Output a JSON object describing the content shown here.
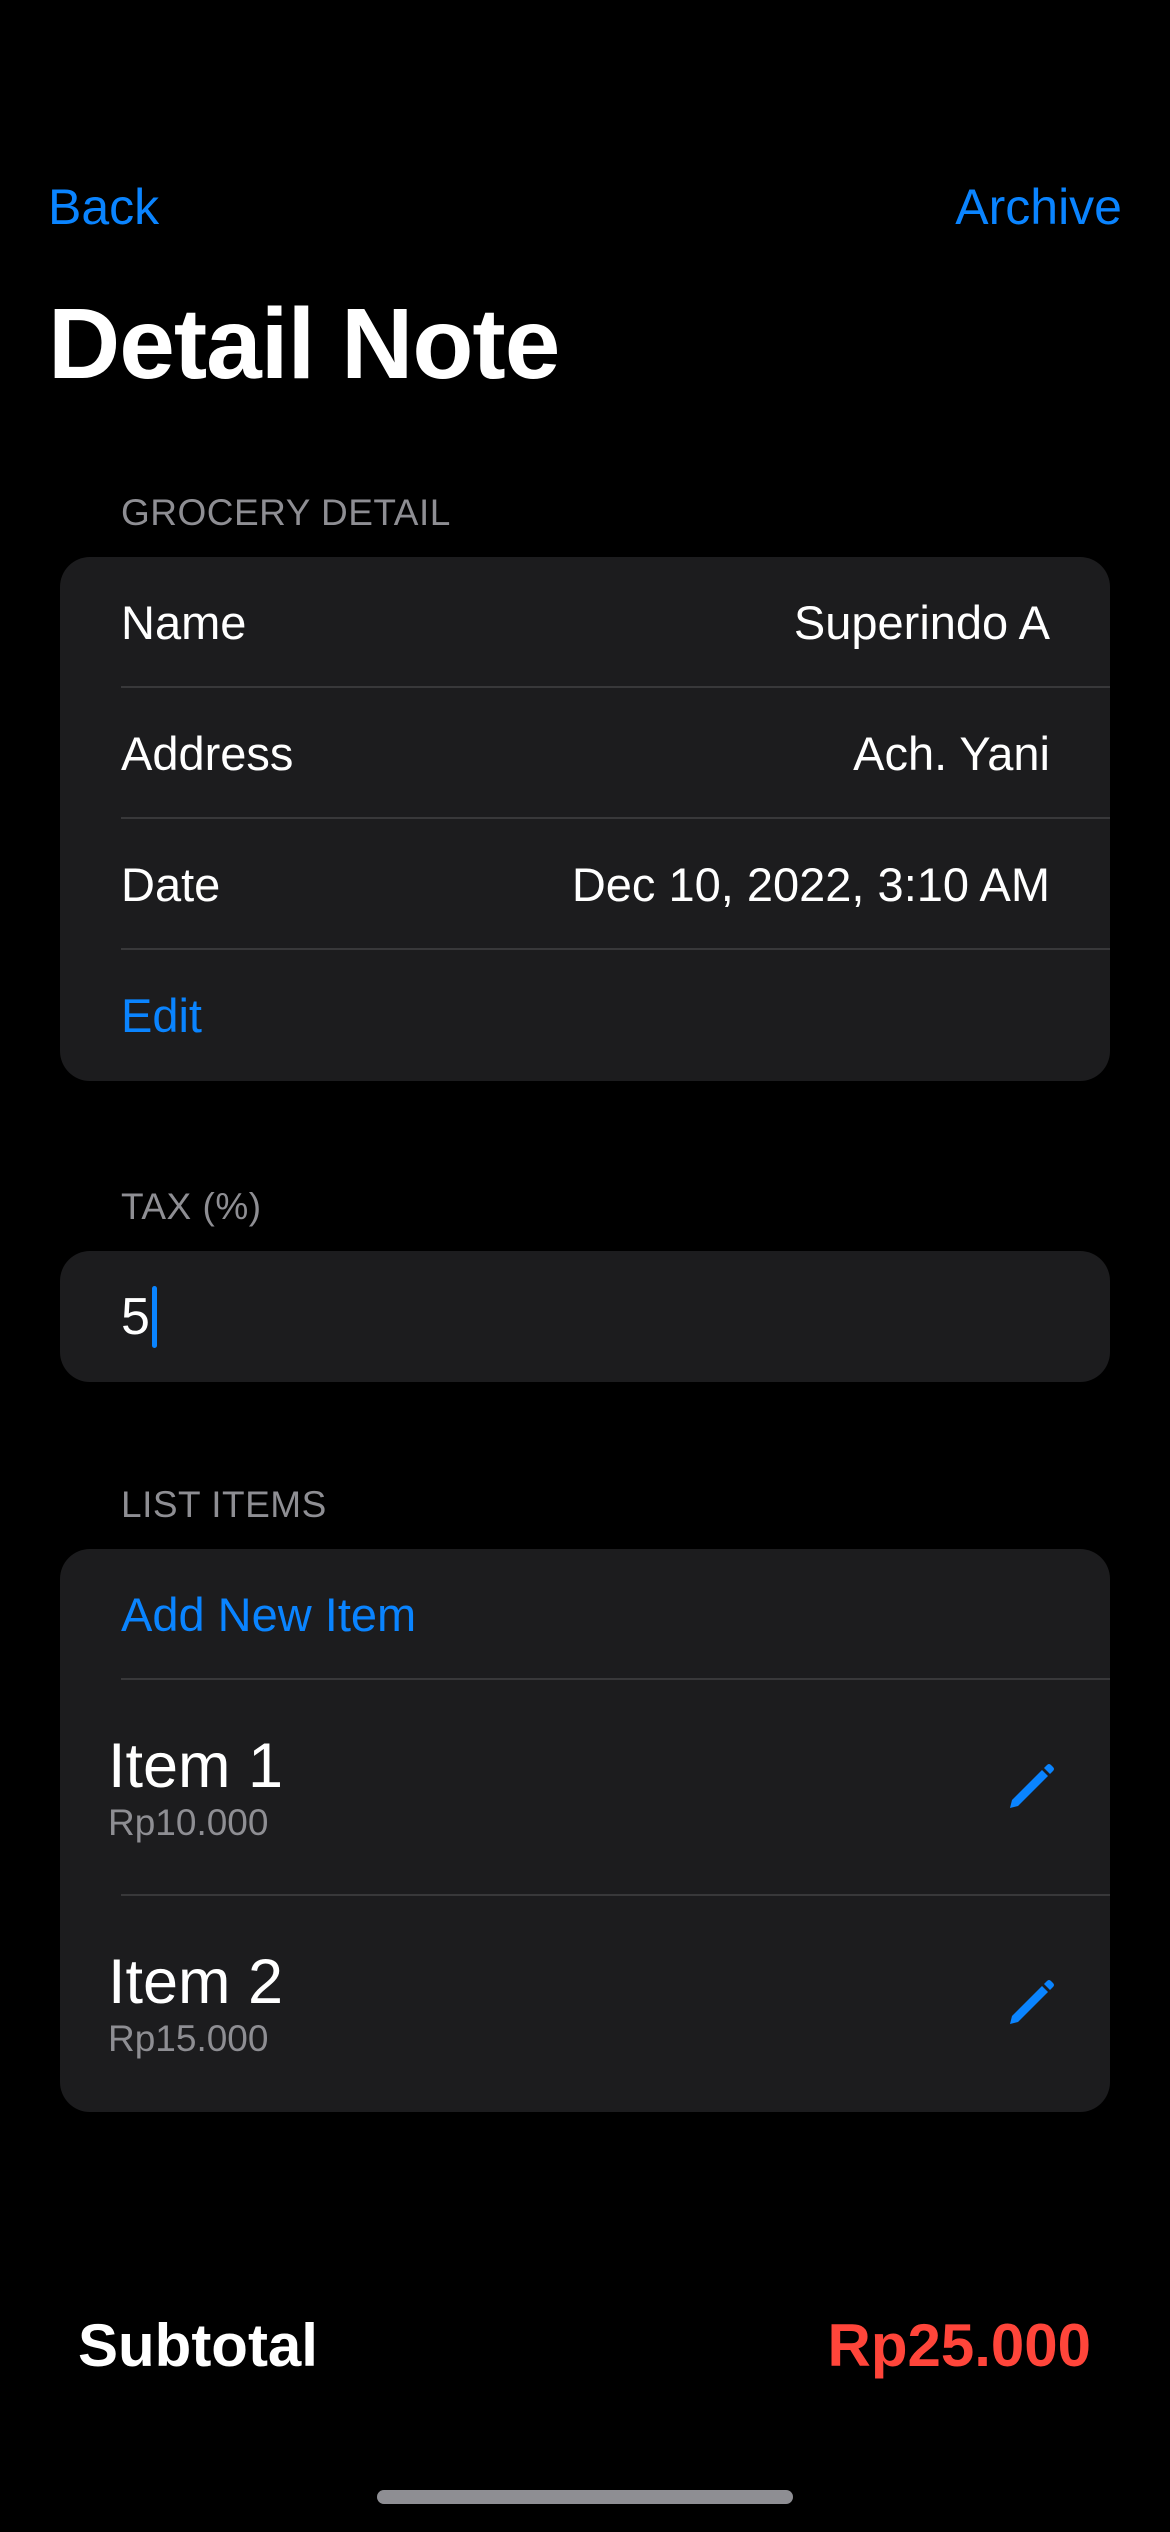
{
  "nav": {
    "back_label": "Back",
    "archive_label": "Archive"
  },
  "title": "Detail Note",
  "grocery_detail": {
    "header": "GROCERY DETAIL",
    "rows": [
      {
        "label": "Name",
        "value": "Superindo A"
      },
      {
        "label": "Address",
        "value": "Ach. Yani"
      },
      {
        "label": "Date",
        "value": "Dec 10, 2022, 3:10 AM"
      }
    ],
    "edit_label": "Edit"
  },
  "tax": {
    "header": "TAX (%)",
    "value": "5"
  },
  "list_items": {
    "header": "LIST ITEMS",
    "add_label": "Add New Item",
    "items": [
      {
        "name": "Item 1",
        "price": "Rp10.000",
        "icon": "pencil-icon"
      },
      {
        "name": "Item 2",
        "price": "Rp15.000",
        "icon": "pencil-icon"
      }
    ]
  },
  "subtotal": {
    "label": "Subtotal",
    "value": "Rp25.000"
  },
  "colors": {
    "background": "#000000",
    "card": "#1c1c1e",
    "accent": "#0a84ff",
    "subtotal": "#ff453a",
    "secondary_text": "#8e8e93"
  }
}
